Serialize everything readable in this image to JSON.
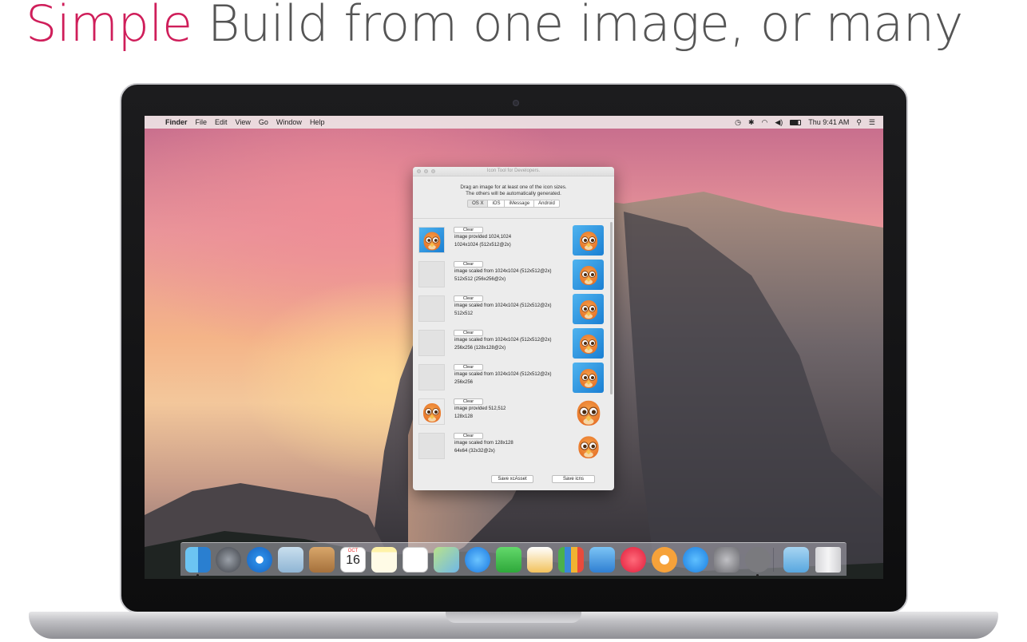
{
  "headline": {
    "accent": "Simple",
    "rest": " Build from one image, or many"
  },
  "menubar": {
    "apple": "",
    "app": "Finder",
    "items": [
      "File",
      "Edit",
      "View",
      "Go",
      "Window",
      "Help"
    ],
    "clock": "Thu 9:41 AM",
    "status_icons": [
      "time-machine-icon",
      "bluetooth-icon",
      "wifi-icon",
      "volume-icon",
      "search-icon",
      "list-icon"
    ]
  },
  "window": {
    "title": "Icon Tool for Developers.",
    "instructions_1": "Drag an image for at least one of the icon sizes.",
    "instructions_2": "The others will be automatically generated.",
    "tabs": [
      "OS X",
      "iOS",
      "iMessage",
      "Android"
    ],
    "selected_tab": "OS X",
    "rows": [
      {
        "clear": "Clear",
        "line1": "image provided 1024,1024",
        "line2": "1024x1024 (512x512@2x)",
        "thumb": true,
        "out_style": "square"
      },
      {
        "clear": "Clear",
        "line1": "image scaled from 1024x1024 (512x512@2x)",
        "line2": "512x512 (256x256@2x)",
        "thumb": false,
        "out_style": "square"
      },
      {
        "clear": "Clear",
        "line1": "image scaled from 1024x1024 (512x512@2x)",
        "line2": "512x512",
        "thumb": false,
        "out_style": "square"
      },
      {
        "clear": "Clear",
        "line1": "image scaled from 1024x1024 (512x512@2x)",
        "line2": "256x256 (128x128@2x)",
        "thumb": false,
        "out_style": "square"
      },
      {
        "clear": "Clear",
        "line1": "image scaled from 1024x1024 (512x512@2x)",
        "line2": "256x256",
        "thumb": false,
        "out_style": "square"
      },
      {
        "clear": "Clear",
        "line1": "image provided 512,512",
        "line2": "128x128",
        "thumb": true,
        "out_style": "plain"
      },
      {
        "clear": "Clear",
        "line1": "image scaled from 128x128",
        "line2": "64x64 (32x32@2x)",
        "thumb": false,
        "out_style": "plain"
      }
    ],
    "save_xcasset": "Save xcAsset",
    "save_icns": "Save icns"
  },
  "dock": {
    "calendar_month": "OCT",
    "calendar_day": "16",
    "apps": [
      "finder-icon",
      "launchpad-icon",
      "safari-icon",
      "mail-icon",
      "contacts-icon",
      "calendar-icon",
      "notes-icon",
      "reminders-icon",
      "maps-icon",
      "messages-icon",
      "facetime-icon",
      "pages-icon",
      "numbers-icon",
      "keynote-icon",
      "itunes-icon",
      "ibooks-icon",
      "app-store-icon",
      "system-preferences-icon",
      "app-icon",
      "downloads-icon",
      "trash-icon"
    ]
  }
}
